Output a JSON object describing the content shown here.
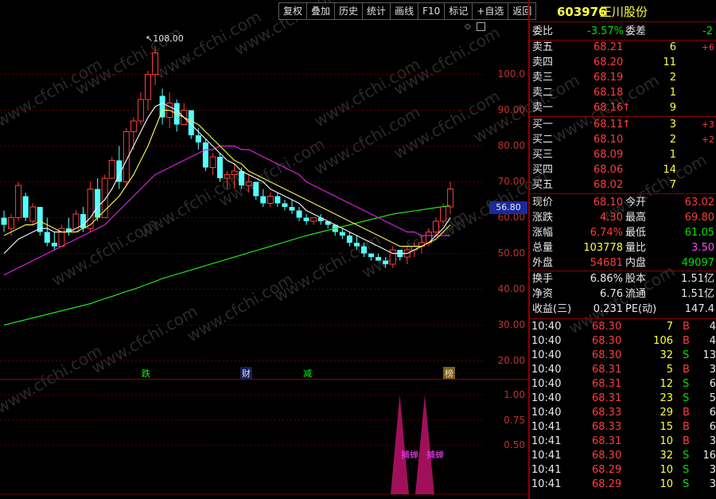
{
  "toolbar": [
    "复权",
    "叠加",
    "历史",
    "统计",
    "画线",
    "F10",
    "标记",
    "+自选",
    "返回"
  ],
  "stock": {
    "code": "603976",
    "name": "正川股份"
  },
  "weibi": {
    "label": "委比",
    "value": "-3.57%",
    "diff_label": "委差",
    "diff": "-2"
  },
  "asks": [
    {
      "label": "卖五",
      "price": "68.21",
      "vol": "6",
      "chg": "+6",
      "arrow": ""
    },
    {
      "label": "卖四",
      "price": "68.20",
      "vol": "11",
      "chg": "",
      "arrow": ""
    },
    {
      "label": "卖三",
      "price": "68.19",
      "vol": "2",
      "chg": "",
      "arrow": ""
    },
    {
      "label": "卖二",
      "price": "68.18",
      "vol": "1",
      "chg": "",
      "arrow": ""
    },
    {
      "label": "卖一",
      "price": "68.16",
      "vol": "9",
      "chg": "",
      "arrow": "↑"
    }
  ],
  "bids": [
    {
      "label": "买一",
      "price": "68.11",
      "vol": "3",
      "chg": "+3",
      "arrow": "↑"
    },
    {
      "label": "买二",
      "price": "68.10",
      "vol": "2",
      "chg": "+2",
      "arrow": ""
    },
    {
      "label": "买三",
      "price": "68.09",
      "vol": "1",
      "chg": "",
      "arrow": ""
    },
    {
      "label": "买四",
      "price": "68.06",
      "vol": "14",
      "chg": "",
      "arrow": ""
    },
    {
      "label": "买五",
      "price": "68.02",
      "vol": "7",
      "chg": "",
      "arrow": ""
    }
  ],
  "quote": [
    {
      "l1": "现价",
      "v1": "68.10",
      "l2": "今开",
      "v2": "63.02"
    },
    {
      "l1": "涨跌",
      "v1": "4.30",
      "l2": "最高",
      "v2": "69.80"
    },
    {
      "l1": "涨幅",
      "v1": "6.74%",
      "l2": "最低",
      "v2": "61.05"
    },
    {
      "l1": "总量",
      "v1": "103778",
      "l2": "量比",
      "v2": "3.50"
    },
    {
      "l1": "外盘",
      "v1": "54681",
      "l2": "内盘",
      "v2": "49097"
    }
  ],
  "fund": [
    {
      "l1": "换手",
      "v1": "6.86%",
      "l2": "股本",
      "v2": "1.51亿"
    },
    {
      "l1": "净资",
      "v1": "6.76",
      "l2": "流通",
      "v2": "1.51亿"
    },
    {
      "l1": "收益(三)",
      "v1": "0.231",
      "l2": "PE(动)",
      "v2": "147.4"
    }
  ],
  "ticks": [
    {
      "time": "10:40",
      "price": "68.30",
      "vol": "7",
      "bs": "B",
      "n": "4"
    },
    {
      "time": "10:40",
      "price": "68.30",
      "vol": "106",
      "bs": "B",
      "n": "4"
    },
    {
      "time": "10:40",
      "price": "68.30",
      "vol": "32",
      "bs": "S",
      "n": "13"
    },
    {
      "time": "10:40",
      "price": "68.31",
      "vol": "5",
      "bs": "B",
      "n": "3"
    },
    {
      "time": "10:40",
      "price": "68.31",
      "vol": "12",
      "bs": "S",
      "n": "6"
    },
    {
      "time": "10:40",
      "price": "68.31",
      "vol": "23",
      "bs": "S",
      "n": "5"
    },
    {
      "time": "10:40",
      "price": "68.33",
      "vol": "29",
      "bs": "B",
      "n": "6"
    },
    {
      "time": "10:41",
      "price": "68.33",
      "vol": "15",
      "bs": "B",
      "n": "6"
    },
    {
      "time": "10:41",
      "price": "68.31",
      "vol": "10",
      "bs": "B",
      "n": "3"
    },
    {
      "time": "10:41",
      "price": "68.30",
      "vol": "32",
      "bs": "S",
      "n": "16"
    },
    {
      "time": "10:41",
      "price": "68.29",
      "vol": "10",
      "bs": "S",
      "n": "3"
    },
    {
      "time": "10:41",
      "price": "68.29",
      "vol": "10",
      "bs": "S",
      "n": "3"
    }
  ],
  "chart": {
    "y_axis": [
      "100.0",
      "90.00",
      "80.00",
      "70.00",
      "60.00",
      "50.00",
      "40.00",
      "30.00",
      "20.00"
    ],
    "high_label": "108.00",
    "current_tag": "56.80",
    "markers": [
      "跌",
      "财",
      "减",
      "榜"
    ],
    "ind_axis": [
      "1.00",
      "0.75",
      "0.50"
    ],
    "ind_labels": [
      "捕蝉",
      "捕蝉"
    ],
    "watermark": "www.cfchi.com"
  },
  "chart_data": {
    "type": "candlestick",
    "ylim": [
      15,
      115
    ],
    "candles": [
      [
        60,
        62,
        56,
        58
      ],
      [
        57,
        61,
        55,
        60
      ],
      [
        60,
        70,
        59,
        69
      ],
      [
        66,
        67,
        59,
        60
      ],
      [
        59,
        64,
        58,
        63
      ],
      [
        63,
        63,
        55,
        56
      ],
      [
        56,
        60,
        52,
        53
      ],
      [
        53,
        56,
        51,
        52
      ],
      [
        52,
        58,
        52,
        57
      ],
      [
        57,
        60,
        55,
        56
      ],
      [
        56,
        62,
        56,
        61
      ],
      [
        61,
        63,
        56,
        57
      ],
      [
        57,
        70,
        56,
        68
      ],
      [
        68,
        71,
        59,
        60
      ],
      [
        60,
        72,
        60,
        71
      ],
      [
        71,
        77,
        71,
        76
      ],
      [
        76,
        80,
        68,
        70
      ],
      [
        70,
        85,
        69,
        84
      ],
      [
        84,
        88,
        79,
        87
      ],
      [
        87,
        95,
        86,
        93
      ],
      [
        93,
        101,
        90,
        100
      ],
      [
        100,
        108,
        97,
        106
      ],
      [
        94,
        96,
        86,
        88
      ],
      [
        88,
        95,
        85,
        92
      ],
      [
        92,
        93,
        84,
        86
      ],
      [
        86,
        92,
        86,
        90
      ],
      [
        90,
        90,
        82,
        83
      ],
      [
        83,
        85,
        79,
        81
      ],
      [
        81,
        82,
        73,
        74
      ],
      [
        74,
        78,
        72,
        77
      ],
      [
        77,
        78,
        70,
        71
      ],
      [
        71,
        73,
        68,
        72
      ],
      [
        72,
        75,
        68,
        73
      ],
      [
        73,
        74,
        68,
        69
      ],
      [
        69,
        72,
        67,
        70
      ],
      [
        70,
        70,
        65,
        66
      ],
      [
        66,
        68,
        63,
        64
      ],
      [
        64,
        67,
        63,
        66
      ],
      [
        66,
        67,
        63,
        64
      ],
      [
        64,
        65,
        62,
        63
      ],
      [
        63,
        65,
        61,
        62
      ],
      [
        62,
        63,
        59,
        60
      ],
      [
        60,
        61,
        58,
        59
      ],
      [
        59,
        60,
        58,
        60
      ],
      [
        60,
        61,
        58,
        59
      ],
      [
        59,
        59,
        57,
        58
      ],
      [
        58,
        58,
        55,
        56
      ],
      [
        56,
        57,
        54,
        55
      ],
      [
        55,
        56,
        52,
        53
      ],
      [
        53,
        55,
        51,
        52
      ],
      [
        52,
        53,
        49,
        50
      ],
      [
        50,
        50,
        48,
        49
      ],
      [
        49,
        50,
        48,
        48
      ],
      [
        48,
        49,
        46,
        47
      ],
      [
        47,
        52,
        46,
        51
      ],
      [
        51,
        51,
        48,
        49
      ],
      [
        49,
        52,
        47,
        51
      ],
      [
        51,
        53,
        49,
        52
      ],
      [
        52,
        55,
        50,
        53
      ],
      [
        53,
        57,
        52,
        56
      ],
      [
        56,
        60,
        55,
        59
      ],
      [
        59,
        64,
        58,
        63
      ],
      [
        63,
        70,
        61,
        68
      ]
    ],
    "ma_yellow": [
      55,
      56,
      57,
      58,
      58,
      59,
      58,
      57,
      56,
      56,
      56,
      57,
      58,
      60,
      62,
      64,
      66,
      69,
      72,
      76,
      80,
      85,
      90,
      90,
      89,
      88,
      87,
      86,
      84,
      82,
      80,
      78,
      76,
      75,
      73,
      72,
      71,
      70,
      69,
      68,
      67,
      66,
      65,
      64,
      63,
      62,
      61,
      60,
      59,
      58,
      57,
      56,
      55,
      54,
      53,
      52,
      52,
      52,
      52,
      53,
      54,
      56,
      58
    ],
    "ma_white": [
      50,
      52,
      54,
      55,
      56,
      57,
      57,
      56,
      56,
      56,
      57,
      58,
      60,
      63,
      65,
      68,
      72,
      76,
      80,
      84,
      88,
      91,
      92,
      91,
      90,
      88,
      86,
      84,
      82,
      80,
      78,
      76,
      75,
      73,
      72,
      71,
      70,
      68,
      67,
      66,
      65,
      64,
      62,
      61,
      60,
      59,
      58,
      57,
      56,
      55,
      54,
      53,
      52,
      51,
      50,
      50,
      50,
      51,
      52,
      53,
      55,
      57,
      60
    ],
    "ma_magenta": [
      44,
      45,
      46,
      47,
      48,
      49,
      50,
      51,
      52,
      53,
      54,
      55,
      56,
      57,
      58,
      60,
      62,
      64,
      66,
      68,
      70,
      72,
      73,
      74,
      75,
      76,
      77,
      78,
      79,
      79,
      80,
      80,
      80,
      79,
      79,
      78,
      77,
      76,
      75,
      74,
      73,
      72,
      70,
      69,
      68,
      67,
      66,
      65,
      64,
      63,
      62,
      61,
      60,
      59,
      58,
      57,
      56,
      56,
      55,
      55,
      55,
      55,
      55
    ],
    "ma_green": [
      30,
      30.5,
      31,
      31.5,
      32,
      32.5,
      33,
      33.5,
      34,
      34.5,
      35,
      35.5,
      36,
      36.7,
      37.4,
      38,
      38.7,
      39.4,
      40,
      40.7,
      41.5,
      42.2,
      43,
      43.6,
      44.2,
      44.8,
      45.4,
      46,
      46.6,
      47.2,
      47.8,
      48.4,
      49,
      49.6,
      50.2,
      50.8,
      51.4,
      52,
      52.6,
      53.2,
      53.8,
      54.4,
      55,
      55.5,
      56,
      56.5,
      57,
      57.5,
      58,
      58.5,
      59,
      59.5,
      60,
      60.5,
      61,
      61.3,
      61.6,
      61.9,
      62.2,
      62.5,
      62.8,
      63.1,
      63.4
    ]
  }
}
